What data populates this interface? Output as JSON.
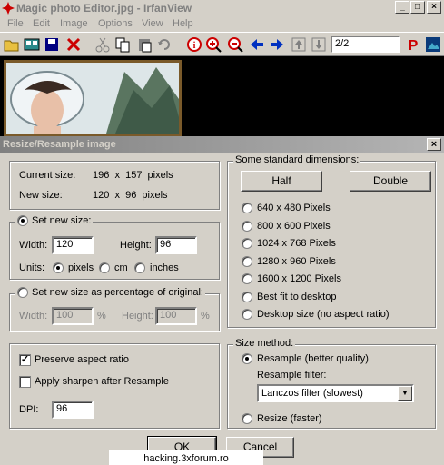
{
  "app": {
    "title": "Magic photo Editor.jpg - IrfanView"
  },
  "menu": [
    "File",
    "Edit",
    "Image",
    "Options",
    "View",
    "Help"
  ],
  "toolbar": {
    "page_value": "2/2",
    "icons": [
      "open-folder",
      "thumbnails",
      "save",
      "delete",
      "cut",
      "copy",
      "paste",
      "undo",
      "info",
      "zoom-in",
      "zoom-out",
      "prev-arrow",
      "next-arrow",
      "first",
      "last",
      "print",
      "logo"
    ]
  },
  "dialog": {
    "title": "Resize/Resample image",
    "current_size_label": "Current size:",
    "current_size_value": "196  x  157  pixels",
    "new_size_label": "New size:",
    "new_size_value": "120  x  96  pixels",
    "set_new_size": "Set new size:",
    "width_label": "Width:",
    "width_value": "120",
    "height_label": "Height:",
    "height_value": "96",
    "units_label": "Units:",
    "unit_pixels": "pixels",
    "unit_cm": "cm",
    "unit_inches": "inches",
    "percent_label": "Set new size as percentage of original:",
    "pct_width_label": "Width:",
    "pct_width_value": "100",
    "pct_height_label": "Height:",
    "pct_height_value": "100",
    "percent_sign": "%",
    "preserve_aspect": "Preserve aspect ratio",
    "apply_sharpen": "Apply sharpen after Resample",
    "dpi_label": "DPI:",
    "dpi_value": "96",
    "standard_dims": "Some standard dimensions:",
    "half": "Half",
    "double": "Double",
    "dims": [
      "640 x 480 Pixels",
      "800 x 600 Pixels",
      "1024 x 768 Pixels",
      "1280 x 960 Pixels",
      "1600 x 1200 Pixels",
      "Best fit to desktop",
      "Desktop size (no aspect ratio)"
    ],
    "size_method": "Size method:",
    "resample": "Resample (better quality)",
    "filter_label": "Resample filter:",
    "filter_value": "Lanczos filter (slowest)",
    "resize_faster": "Resize (faster)",
    "ok": "OK",
    "cancel": "Cancel"
  },
  "watermark": "hacking.3xforum.ro"
}
